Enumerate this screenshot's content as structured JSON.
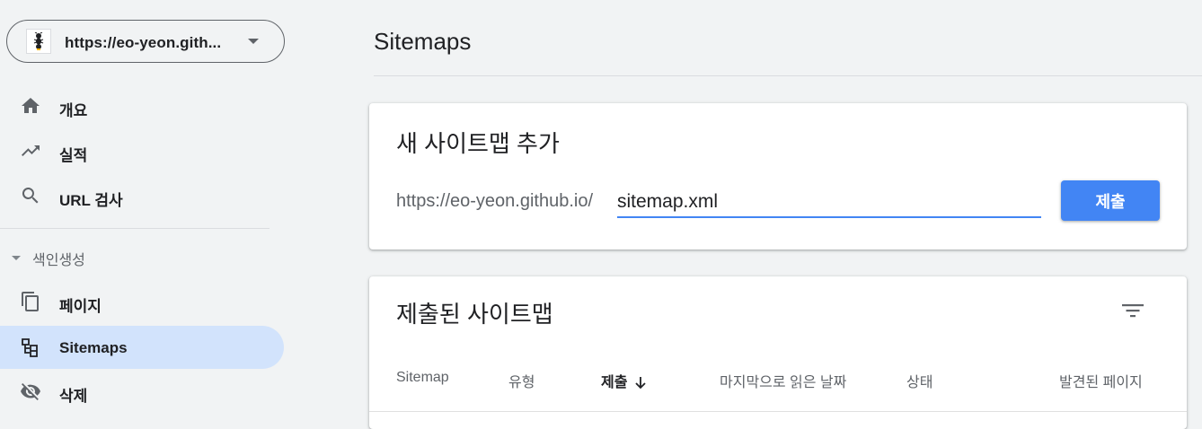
{
  "property": {
    "url": "https://eo-yeon.gith...",
    "favicon_icon": "ant-icon",
    "caret_icon": "caret-down-icon"
  },
  "nav": {
    "overview": {
      "label": "개요",
      "icon": "home-icon"
    },
    "performance": {
      "label": "실적",
      "icon": "trending-up-icon"
    },
    "url_inspection": {
      "label": "URL 검사",
      "icon": "search-icon"
    },
    "indexing_section": {
      "label": "색인생성",
      "icon": "caret-down-icon"
    },
    "pages": {
      "label": "페이지",
      "icon": "copy-icon"
    },
    "sitemaps": {
      "label": "Sitemaps",
      "icon": "sitemap-icon",
      "active": true
    },
    "removals": {
      "label": "삭제",
      "icon": "eye-off-icon"
    }
  },
  "main": {
    "title": "Sitemaps",
    "add_card": {
      "title": "새 사이트맵 추가",
      "url_prefix": "https://eo-yeon.github.io/",
      "input_value": "sitemap.xml",
      "submit_label": "제출"
    },
    "submitted_card": {
      "title": "제출된 사이트맵",
      "filter_icon": "filter-icon",
      "columns": [
        "Sitemap",
        "유형",
        "제출",
        "마지막으로 읽은 날짜",
        "상태",
        "발견된 페이지"
      ],
      "sorted_column": "제출",
      "sort_direction": "descending"
    }
  },
  "colors": {
    "accent": "#4285f4",
    "active_nav_bg": "#d2e3fc",
    "page_bg": "#f1f3f4"
  }
}
